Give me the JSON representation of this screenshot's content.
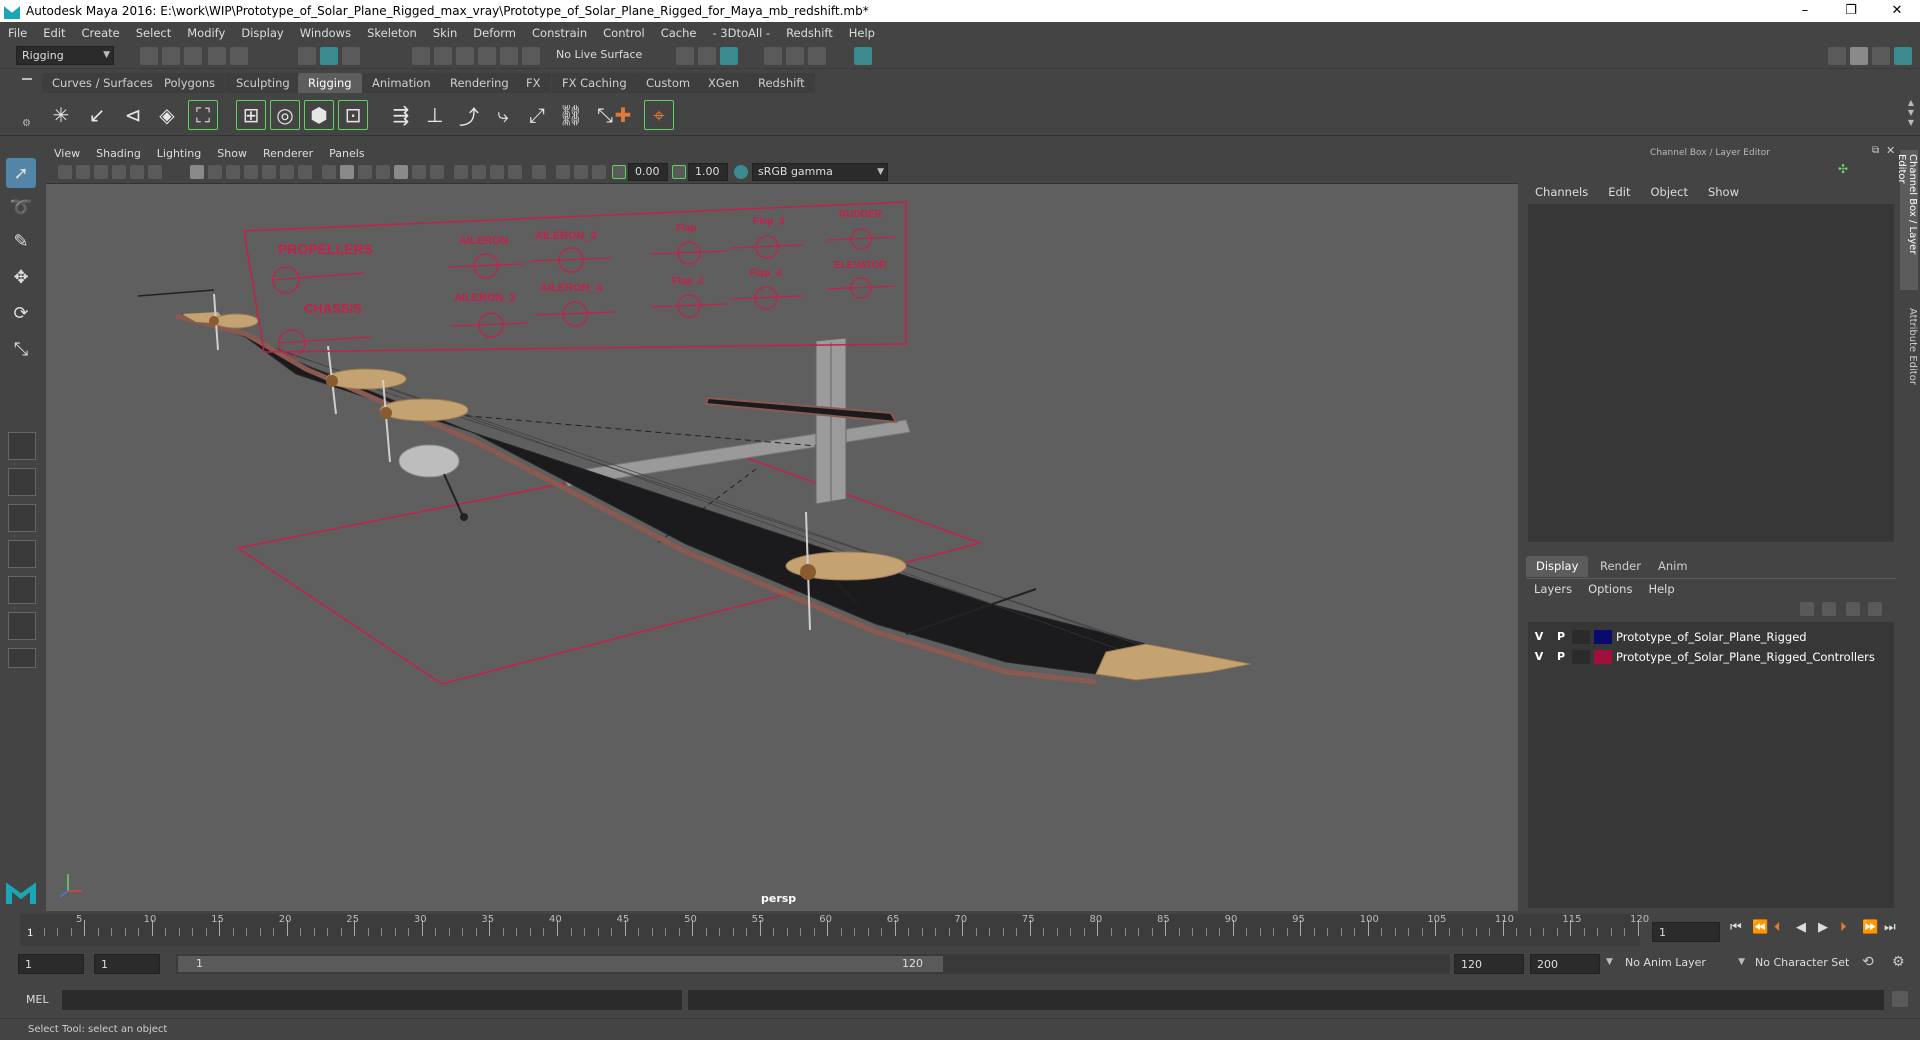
{
  "window": {
    "title": "Autodesk Maya 2016: E:\\work\\WIP\\Prototype_of_Solar_Plane_Rigged_max_vray\\Prototype_of_Solar_Plane_Rigged_for_Maya_mb_redshift.mb*",
    "minimize": "–",
    "maximize": "❐",
    "close": "✕"
  },
  "menubar": [
    "File",
    "Edit",
    "Create",
    "Select",
    "Modify",
    "Display",
    "Windows",
    "Skeleton",
    "Skin",
    "Deform",
    "Constrain",
    "Control",
    "Cache",
    "- 3DtoAll -",
    "Redshift",
    "Help"
  ],
  "statusline": {
    "menuset": "Rigging",
    "live_surface": "No Live Surface"
  },
  "shelf_tabs": [
    "Curves / Surfaces",
    "Polygons",
    "Sculpting",
    "Rigging",
    "Animation",
    "Rendering",
    "FX",
    "FX Caching",
    "Custom",
    "XGen",
    "Redshift"
  ],
  "shelf_active_tab": "Rigging",
  "viewport": {
    "menus": [
      "View",
      "Shading",
      "Lighting",
      "Show",
      "Renderer",
      "Panels"
    ],
    "near_value": "0.00",
    "far_value": "1.00",
    "color_space": "sRGB gamma",
    "camera_label": "persp",
    "control_board": {
      "labels": [
        "PROPELLERS",
        "CHASSIS",
        "AILERON",
        "AILERON_2",
        "AILERON_3",
        "AILERON_4",
        "Flap",
        "Flap_2",
        "Flap_3",
        "Flap_4",
        "RUDDER",
        "ELEVATOR"
      ]
    },
    "colors": {
      "background": "#5f5f5f",
      "controller": "#c4214a",
      "wing": "#1b1b1e",
      "wing_edge": "#8a5a50",
      "nacelle": "#c4a271"
    }
  },
  "channel_box": {
    "header": "Channel Box / Layer Editor",
    "menus": [
      "Channels",
      "Edit",
      "Object",
      "Show"
    ]
  },
  "layer_editor": {
    "tabs": [
      "Display",
      "Render",
      "Anim"
    ],
    "active_tab": "Display",
    "menus": [
      "Layers",
      "Options",
      "Help"
    ],
    "layers": [
      {
        "v": "V",
        "p": "P",
        "color": "#0a0a6e",
        "name": "Prototype_of_Solar_Plane_Rigged"
      },
      {
        "v": "V",
        "p": "P",
        "color": "#a0103a",
        "name": "Prototype_of_Solar_Plane_Rigged_Controllers"
      }
    ]
  },
  "side_tabs": [
    "Channel Box / Layer Editor",
    "Attribute Editor"
  ],
  "time_slider": {
    "ticks": [
      "5",
      "10",
      "15",
      "20",
      "25",
      "30",
      "35",
      "40",
      "45",
      "50",
      "55",
      "60",
      "65",
      "70",
      "75",
      "80",
      "85",
      "90",
      "95",
      "100",
      "105",
      "110",
      "115",
      "120"
    ],
    "current_frame_marker": "1",
    "current_frame_field": "1"
  },
  "range_slider": {
    "start_time": "1",
    "playback_start": "1",
    "range_start_label": "1",
    "range_end_label": "120",
    "playback_end": "120",
    "end_time": "200",
    "anim_layer": "No Anim Layer",
    "character_set": "No Character Set"
  },
  "command_line": {
    "label": "MEL"
  },
  "help_line": {
    "text": "Select Tool: select an object"
  }
}
